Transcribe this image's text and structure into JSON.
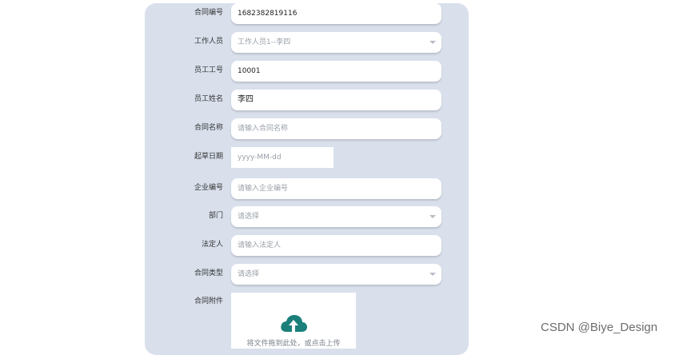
{
  "form": {
    "contract_no": {
      "label": "合同编号",
      "value": "1682382819116"
    },
    "worker": {
      "label": "工作人员",
      "placeholder": "工作人员1--李四"
    },
    "employee_id": {
      "label": "员工工号",
      "value": "10001"
    },
    "employee_name": {
      "label": "员工姓名",
      "value": "李四"
    },
    "contract_name": {
      "label": "合同名称",
      "placeholder": "请输入合同名称"
    },
    "draft_date": {
      "label": "起草日期",
      "placeholder": "yyyy-MM-dd"
    },
    "company_no": {
      "label": "企业编号",
      "placeholder": "请输入企业编号"
    },
    "department": {
      "label": "部门",
      "placeholder": "请选择"
    },
    "legal_person": {
      "label": "法定人",
      "placeholder": "请输入法定人"
    },
    "contract_type": {
      "label": "合同类型",
      "placeholder": "请选择"
    },
    "attachment": {
      "label": "合同附件",
      "hint": "将文件拖到此处，或点击上传",
      "icon": "cloud-upload-icon"
    }
  },
  "colors": {
    "panel": "#d9e0ec",
    "upload_icon": "#1a7f7a"
  },
  "watermark": "CSDN @Biye_Design"
}
